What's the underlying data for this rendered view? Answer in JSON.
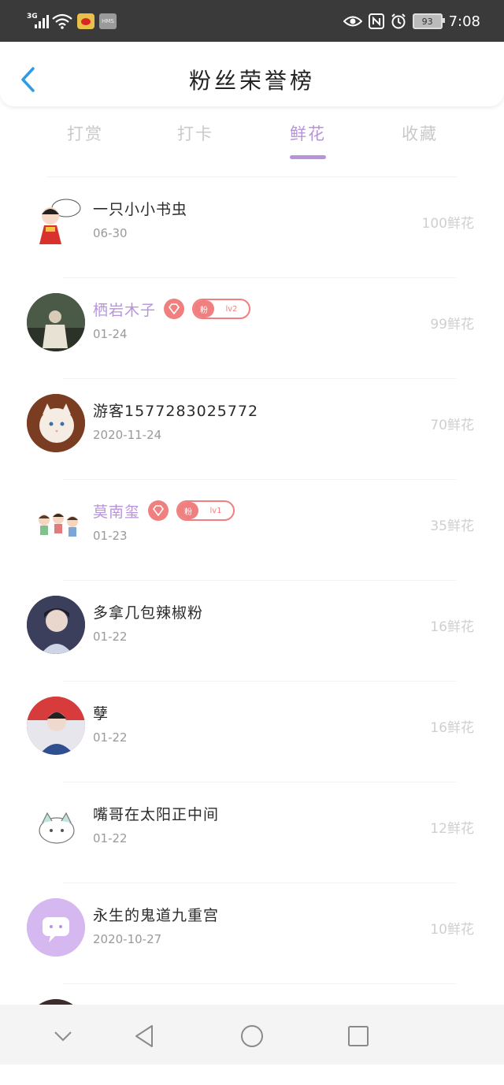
{
  "status_bar": {
    "network": "3G",
    "battery": "93",
    "time": "7:08",
    "hms_label": "HMS",
    "icons": [
      "signal-icon",
      "wifi-icon",
      "weibo-icon",
      "hms-icon",
      "eye-icon",
      "nfc-icon",
      "alarm-icon",
      "battery-icon"
    ]
  },
  "header": {
    "title": "粉丝荣誉榜"
  },
  "tabs": [
    {
      "label": "打赏",
      "active": false
    },
    {
      "label": "打卡",
      "active": false
    },
    {
      "label": "鲜花",
      "active": true
    },
    {
      "label": "收藏",
      "active": false
    }
  ],
  "fans": [
    {
      "name": "一只小小书虫",
      "date": "06-30",
      "count": "100鲜花"
    },
    {
      "name": "栖岩木子",
      "date": "01-24",
      "count": "99鲜花",
      "badge": {
        "fan": "粉",
        "level": "lv2"
      }
    },
    {
      "name": "游客1577283025772",
      "date": "2020-11-24",
      "count": "70鲜花"
    },
    {
      "name": "莫南玺",
      "date": "01-23",
      "count": "35鲜花",
      "badge": {
        "fan": "粉",
        "level": "lv1"
      }
    },
    {
      "name": "多拿几包辣椒粉",
      "date": "01-22",
      "count": "16鲜花"
    },
    {
      "name": "孽",
      "date": "01-22",
      "count": "16鲜花"
    },
    {
      "name": "嘴哥在太阳正中间",
      "date": "01-22",
      "count": "12鲜花"
    },
    {
      "name": "永生的鬼道九重宫",
      "date": "2020-10-27",
      "count": "10鲜花"
    }
  ],
  "colors": {
    "accent": "#b893dc",
    "badge": "#f07f7f",
    "status_bar": "#3a3a3a"
  },
  "nav_bar": {
    "icons": [
      "chevron-down-icon",
      "back-triangle-icon",
      "home-circle-icon",
      "recents-square-icon"
    ]
  }
}
